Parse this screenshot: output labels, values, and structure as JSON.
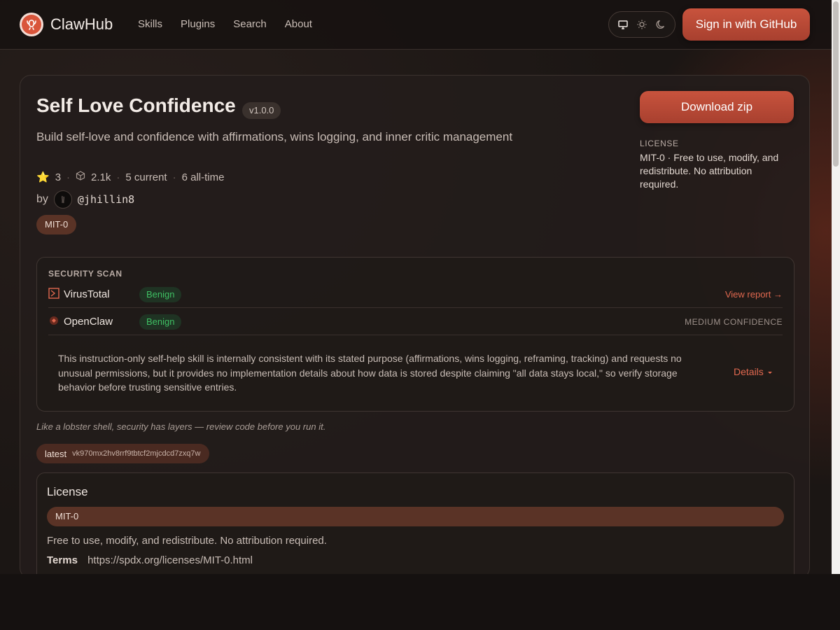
{
  "header": {
    "brand": "ClawHub",
    "nav": [
      "Skills",
      "Plugins",
      "Search",
      "About"
    ],
    "signin_label": "Sign in  with GitHub"
  },
  "skill": {
    "title": "Self Love Confidence",
    "version": "v1.0.0",
    "description": "Build self-love and confidence with affirmations, wins logging, and inner critic management",
    "stars": "3",
    "downloads": "2.1k",
    "current": "5 current",
    "all_time": "6 all-time",
    "by_label": "by",
    "author": "@jhillin8",
    "license_badge": "MIT-0"
  },
  "sidebar": {
    "download_label": "Download zip",
    "license_label": "LICENSE",
    "license_text": "MIT-0 · Free to use, modify, and redistribute. No attribution required."
  },
  "security": {
    "label": "SECURITY SCAN",
    "scanners": [
      {
        "name": "VirusTotal",
        "status": "Benign",
        "right": "View report →"
      },
      {
        "name": "OpenClaw",
        "status": "Benign",
        "right": "MEDIUM CONFIDENCE"
      }
    ],
    "summary": "This instruction-only self-help skill is internally consistent with its stated purpose (affirmations, wins logging, reframing, tracking) and requests no unusual permissions, but it provides no implementation details about how data is stored despite claiming \"all data stays local,\" so verify storage behavior before trusting sensitive entries.",
    "details_label": "Details"
  },
  "note": "Like a lobster shell, security has layers — review code before you run it.",
  "tag": {
    "name": "latest",
    "hash": "vk970mx2hv8rrf9tbtcf2mjcdcd7zxq7w"
  },
  "license_section": {
    "title": "License",
    "badge": "MIT-0",
    "text": "Free to use, modify, and redistribute. No attribution required.",
    "terms_label": "Terms",
    "terms_url": "https://spdx.org/licenses/MIT-0.html"
  },
  "colors": {
    "accent": "#c8533d",
    "link": "#e0684f",
    "benign": "#3fbf63"
  }
}
